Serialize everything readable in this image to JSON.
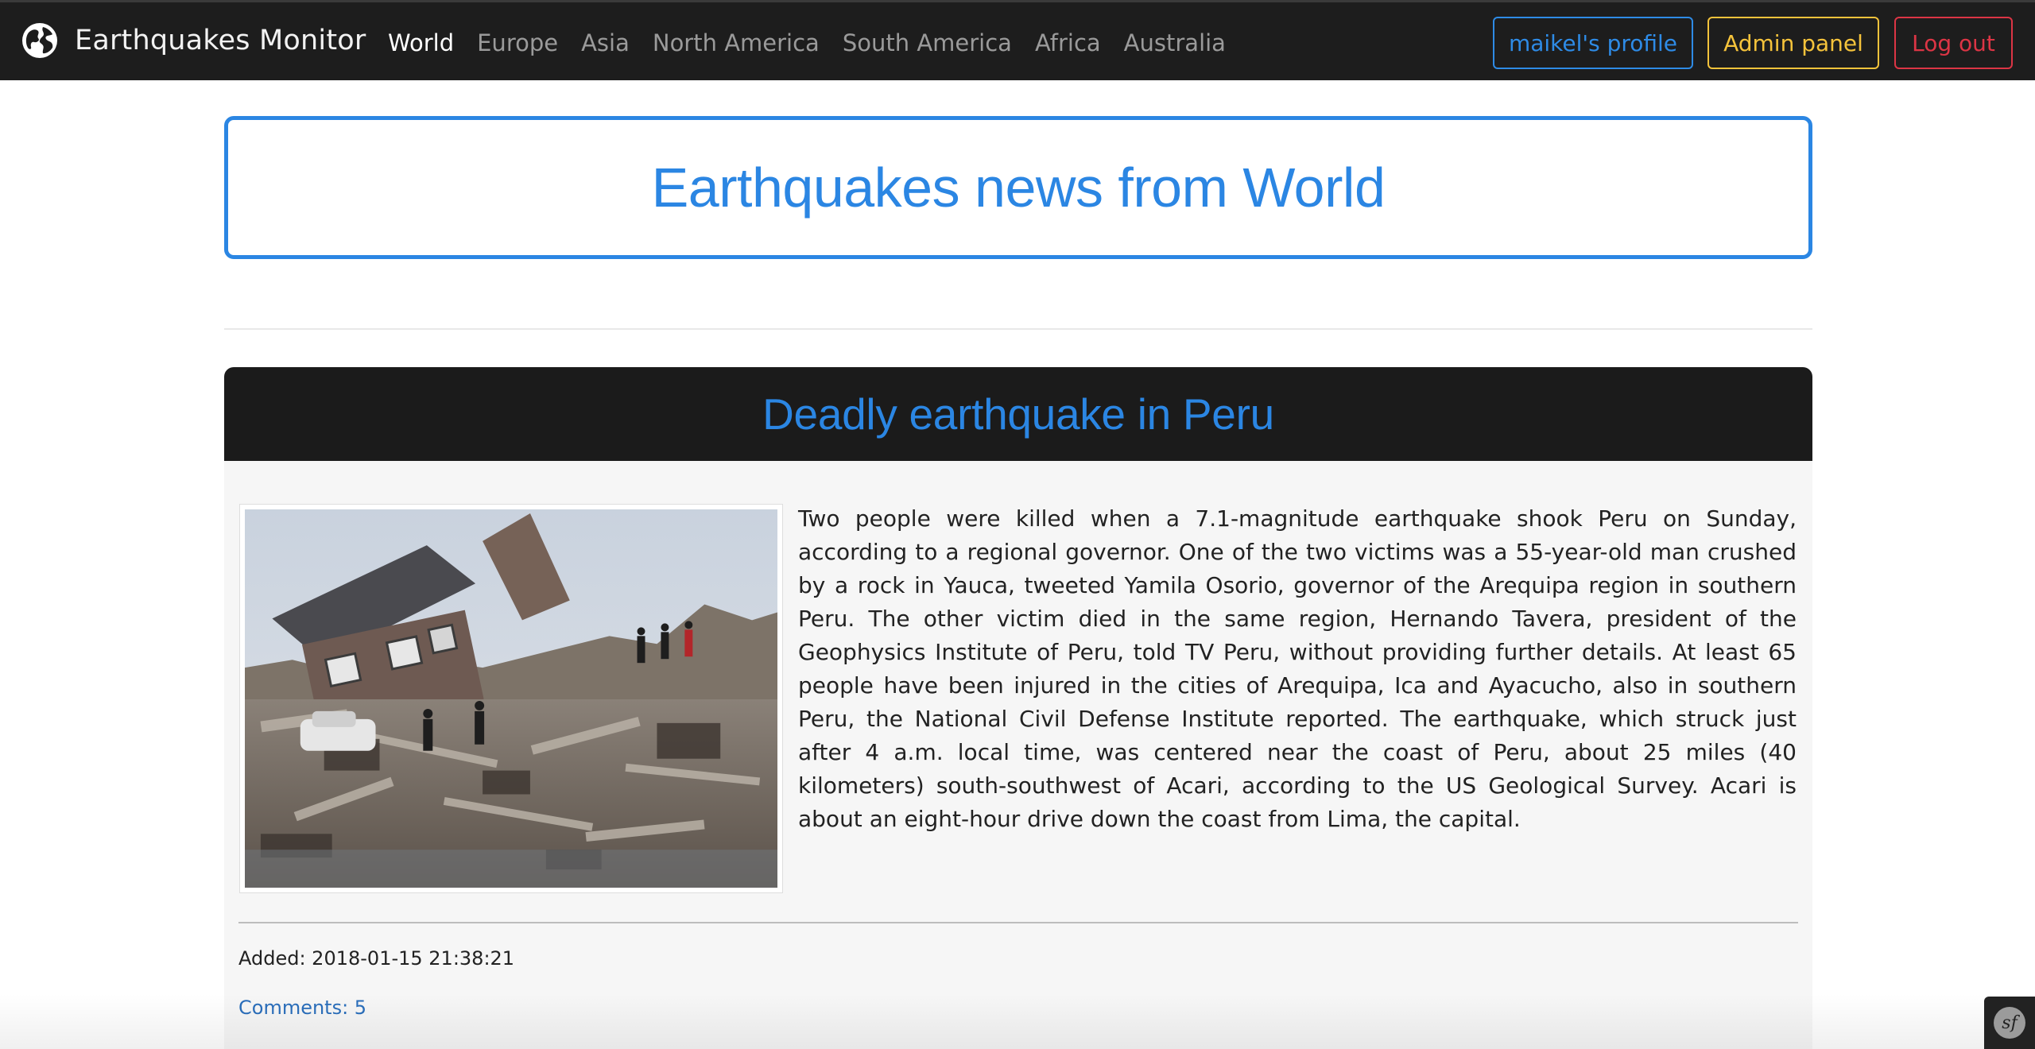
{
  "app": {
    "brand": "Earthquakes Monitor",
    "brand_icon": "globe-icon"
  },
  "nav": {
    "links": [
      {
        "label": "World",
        "active": true
      },
      {
        "label": "Europe",
        "active": false
      },
      {
        "label": "Asia",
        "active": false
      },
      {
        "label": "North America",
        "active": false
      },
      {
        "label": "South America",
        "active": false
      },
      {
        "label": "Africa",
        "active": false
      },
      {
        "label": "Australia",
        "active": false
      }
    ],
    "profile_button": "maikel's profile",
    "admin_button": "Admin panel",
    "logout_button": "Log out"
  },
  "colors": {
    "accent": "#2b86e3",
    "profile": "#2e8be6",
    "admin": "#f5c33b",
    "logout": "#dc3545",
    "navbar_bg": "#1d1d1d"
  },
  "main": {
    "heading": "Earthquakes news from World"
  },
  "article": {
    "title": "Deadly earthquake in Peru",
    "image_alt": "earthquake-rubble-photo",
    "body": "Two people were killed when a 7.1-magnitude earthquake shook Peru on Sunday, according to a regional governor. One of the two victims was a 55-year-old man crushed by a rock in Yauca, tweeted Yamila Osorio, governor of the Arequipa region in southern Peru. The other victim died in the same region, Hernando Tavera, president of the Geophysics Institute of Peru, told TV Peru, without providing further details. At least 65 people have been injured in the cities of Arequipa, Ica and Ayacucho, also in southern Peru, the National Civil Defense Institute reported. The earthquake, which struck just after 4 a.m. local time, was centered near the coast of Peru, about 25 miles (40 kilometers) south-southwest of Acari, according to the US Geological Survey. Acari is about an eight-hour drive down the coast from Lima, the capital.",
    "added": "Added: 2018-01-15 21:38:21",
    "comments": "Comments: 5"
  },
  "toolbar": {
    "symfony_icon": "symfony-icon",
    "symfony_glyph": "sf"
  }
}
